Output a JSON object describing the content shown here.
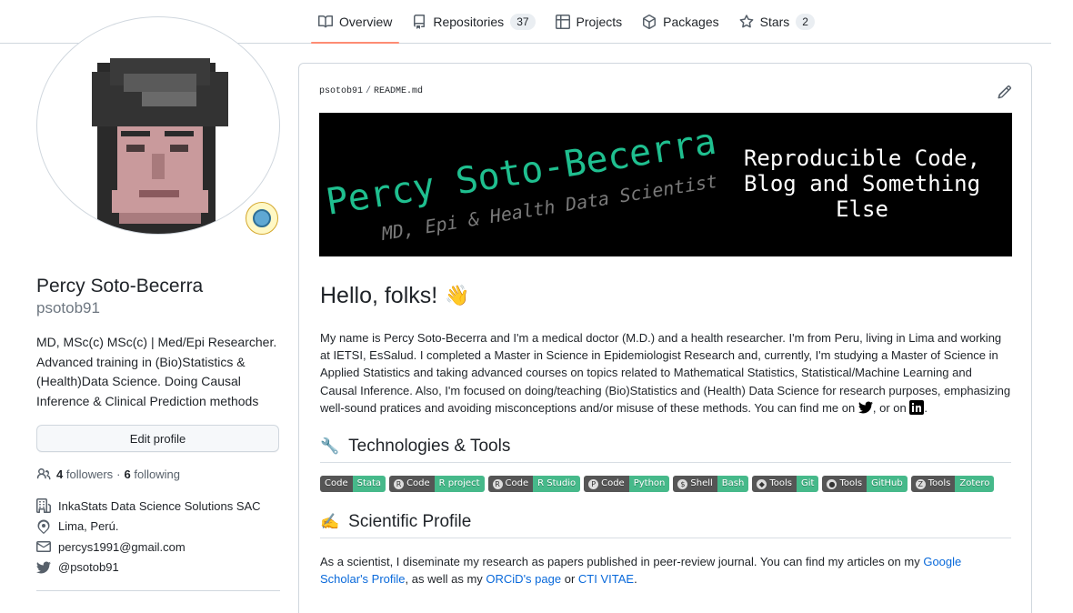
{
  "nav": {
    "tabs": [
      {
        "label": "Overview",
        "icon": "book-icon",
        "count": ""
      },
      {
        "label": "Repositories",
        "icon": "repo-icon",
        "count": "37"
      },
      {
        "label": "Projects",
        "icon": "table-icon",
        "count": ""
      },
      {
        "label": "Packages",
        "icon": "package-icon",
        "count": ""
      },
      {
        "label": "Stars",
        "icon": "star-icon",
        "count": "2"
      }
    ]
  },
  "profile": {
    "fullname": "Percy Soto-Becerra",
    "username": "psotob91",
    "bio": "MD, MSc(c) MSc(c) | Med/Epi Researcher. Advanced training in (Bio)Statistics & (Health)Data Science. Doing Causal Inference & Clinical Prediction methods",
    "edit_label": "Edit profile",
    "followers_count": "4",
    "followers_label": "followers",
    "following_count": "6",
    "following_label": "following",
    "separator": "·",
    "company": "InkaStats Data Science Solutions SAC",
    "location": "Lima, Perú.",
    "email": "percys1991@gmail.com",
    "twitter": "@psotob91"
  },
  "readme": {
    "owner": "psotob91",
    "sep": "/",
    "file": "README.md",
    "banner": {
      "title": "Percy Soto-Becerra",
      "subtitle": "MD, Epi & Health Data Scientist",
      "tagline_1": "Reproducible Code,",
      "tagline_2": "Blog and Something",
      "tagline_3": "Else"
    },
    "heading": "Hello, folks!",
    "heading_emoji": "👋",
    "intro": "My name is Percy Soto-Becerra and I'm a medical doctor (M.D.) and a health researcher. I'm from Peru, living in Lima and working at IETSI, EsSalud. I completed a Master in Science in Epidemiologist Research and, currently, I'm studying a Master of Science in Applied Statistics and taking advanced courses on topics related to Mathematical Statistics, Statistical/Machine Learning and Causal Inference. Also, I'm focused on doing/teaching (Bio)Statistics and (Health) Data Science for research purposes, emphasizing well-sound pratices and avoiding misconceptions and/or misuse of these methods. You can find me on",
    "intro_mid": ", or on",
    "intro_end": ".",
    "tools_heading": "Technologies & Tools",
    "tools_emoji": "🔧",
    "badges": [
      {
        "left": "Code",
        "right": "Stata",
        "icon": ""
      },
      {
        "left": "Code",
        "right": "R project",
        "icon": "R"
      },
      {
        "left": "Code",
        "right": "R Studio",
        "icon": "R"
      },
      {
        "left": "Code",
        "right": "Python",
        "icon": "P"
      },
      {
        "left": "Shell",
        "right": "Bash",
        "icon": "$"
      },
      {
        "left": "Tools",
        "right": "Git",
        "icon": "◆"
      },
      {
        "left": "Tools",
        "right": "GitHub",
        "icon": "●"
      },
      {
        "left": "Tools",
        "right": "Zotero",
        "icon": "Z"
      }
    ],
    "sci_heading": "Scientific Profile",
    "sci_emoji": "✍️",
    "sci_text_1": "As a scientist, I diseminate my research as papers published in peer-review journal. You can find my articles on my",
    "sci_link_1": "Google Scholar's Profile",
    "sci_text_2": ", as well as my",
    "sci_link_2": "ORCiD's page",
    "sci_text_3": "or",
    "sci_link_3": "CTI VITAE",
    "sci_text_4": "."
  },
  "colors": {
    "accent_underline": "#fd8c73",
    "link": "#0969da",
    "badge_right": "#46b98a",
    "badge_left": "#555555",
    "banner_bg": "#000000",
    "banner_title": "#1fbf8f"
  }
}
